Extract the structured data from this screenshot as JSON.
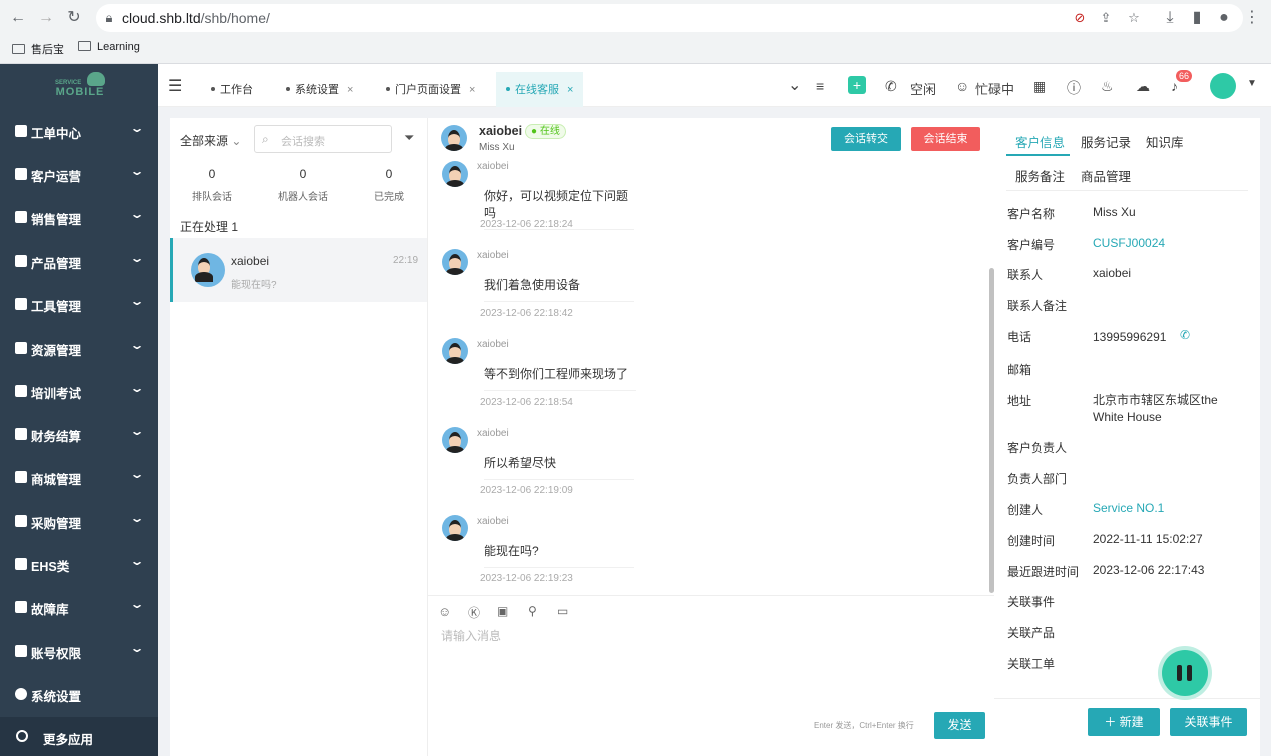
{
  "browser": {
    "url_host": "cloud.shb.ltd",
    "url_path": "/shb/home/",
    "bookmarks": [
      "售后宝",
      "Learning"
    ]
  },
  "sidebar": {
    "logo_top": "SERVICE",
    "logo_bottom": "MOBILE",
    "items": [
      {
        "label": "工单中心"
      },
      {
        "label": "客户运营"
      },
      {
        "label": "销售管理"
      },
      {
        "label": "产品管理"
      },
      {
        "label": "工具管理"
      },
      {
        "label": "资源管理"
      },
      {
        "label": "培训考试"
      },
      {
        "label": "财务结算"
      },
      {
        "label": "商城管理"
      },
      {
        "label": "采购管理"
      },
      {
        "label": "EHS类"
      },
      {
        "label": "故障库"
      },
      {
        "label": "账号权限"
      },
      {
        "label": "系统设置"
      }
    ],
    "more": "更多应用"
  },
  "tabs": [
    {
      "label": "工作台",
      "closable": false
    },
    {
      "label": "系统设置",
      "closable": true
    },
    {
      "label": "门户页面设置",
      "closable": true
    },
    {
      "label": "在线客服",
      "closable": true,
      "active": true
    }
  ],
  "topbar": {
    "status_idle": "空闲",
    "status_busy": "忙碌中",
    "notification_count": "66"
  },
  "conversations": {
    "source_filter": "全部来源",
    "search_placeholder": "会话搜索",
    "stats": [
      {
        "value": "0",
        "label": "排队会话"
      },
      {
        "value": "0",
        "label": "机器人会话"
      },
      {
        "value": "0",
        "label": "已完成"
      }
    ],
    "processing_label": "正在处理 1",
    "items": [
      {
        "name": "xaiobei",
        "time": "22:19",
        "preview": "能现在吗?"
      }
    ]
  },
  "chat": {
    "customer_name": "xaiobei",
    "online_badge": "在线",
    "customer_sub": "Miss Xu",
    "transfer_button": "会话转交",
    "end_button": "会话结束",
    "messages": [
      {
        "sender": "xaiobei",
        "text": "你好，可以视频定位下问题吗",
        "time": "2023-12-06 22:18:24"
      },
      {
        "sender": "xaiobei",
        "text": "我们着急使用设备",
        "time": "2023-12-06 22:18:42"
      },
      {
        "sender": "xaiobei",
        "text": "等不到你们工程师来现场了",
        "time": "2023-12-06 22:18:54"
      },
      {
        "sender": "xaiobei",
        "text": "所以希望尽快",
        "time": "2023-12-06 22:19:09"
      },
      {
        "sender": "xaiobei",
        "text": "能现在吗?",
        "time": "2023-12-06 22:19:23"
      }
    ],
    "input_placeholder": "请输入消息",
    "send_hint": "Enter 发送，Ctrl+Enter 换行",
    "send_button": "发送"
  },
  "info_panel": {
    "tabs_row1": [
      "客户信息",
      "服务记录",
      "知识库"
    ],
    "tabs_row2": [
      "服务备注",
      "商品管理"
    ],
    "fields": [
      {
        "label": "客户名称",
        "value": "Miss Xu"
      },
      {
        "label": "客户编号",
        "value": "CUSFJ00024",
        "link": true
      },
      {
        "label": "联系人",
        "value": "xaiobei"
      },
      {
        "label": "联系人备注",
        "value": ""
      },
      {
        "label": "电话",
        "value": "13995996291"
      },
      {
        "label": "邮箱",
        "value": ""
      },
      {
        "label": "地址",
        "value": "北京市市辖区东城区the White House"
      },
      {
        "label": "客户负责人",
        "value": ""
      },
      {
        "label": "负责人部门",
        "value": ""
      },
      {
        "label": "创建人",
        "value": "Service NO.1",
        "link": true
      },
      {
        "label": "创建时间",
        "value": "2022-11-11 15:02:27"
      },
      {
        "label": "最近跟进时间",
        "value": "2023-12-06 22:17:43"
      },
      {
        "label": "关联事件",
        "value": ""
      },
      {
        "label": "关联产品",
        "value": ""
      },
      {
        "label": "关联工单",
        "value": ""
      }
    ],
    "new_button": "新建",
    "link_event_button": "关联事件"
  },
  "colors": {
    "accent": "#26a8b5",
    "danger": "#f25d5d",
    "sidebar": "#2f4050"
  }
}
